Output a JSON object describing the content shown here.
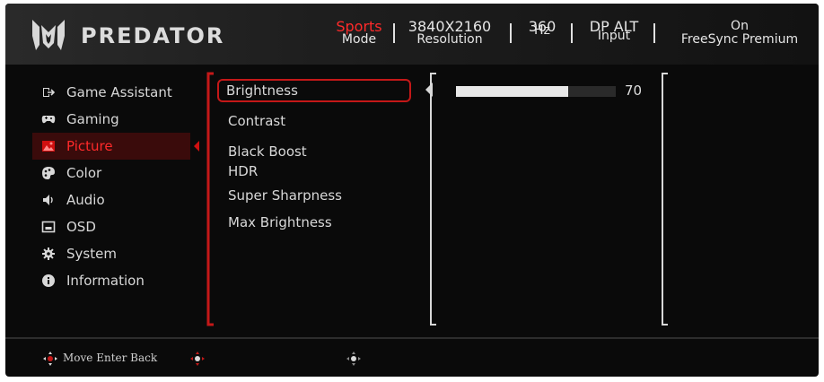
{
  "brand": {
    "name": "PREDATOR"
  },
  "header": {
    "mode": {
      "value": "Sports",
      "label": "Mode"
    },
    "resolution": {
      "value": "3840X2160",
      "label": "Resolution"
    },
    "refresh": {
      "value": "360",
      "label": "Hz"
    },
    "input": {
      "value": "DP ALT",
      "label": "Input"
    },
    "freesync": {
      "value": "On",
      "label": "FreeSync Premium"
    }
  },
  "sidebar": {
    "items": [
      {
        "label": "Game Assistant",
        "icon": "game-assistant-icon"
      },
      {
        "label": "Gaming",
        "icon": "gamepad-icon"
      },
      {
        "label": "Picture",
        "icon": "picture-icon",
        "active": true
      },
      {
        "label": "Color",
        "icon": "palette-icon"
      },
      {
        "label": "Audio",
        "icon": "speaker-icon"
      },
      {
        "label": "OSD",
        "icon": "osd-icon"
      },
      {
        "label": "System",
        "icon": "gear-icon"
      },
      {
        "label": "Information",
        "icon": "info-icon"
      }
    ]
  },
  "submenu": {
    "items": [
      {
        "label": "Brightness",
        "selected": true
      },
      {
        "label": "Contrast"
      },
      {
        "label": "Black Boost"
      },
      {
        "label": "HDR"
      },
      {
        "label": "Super Sharpness"
      },
      {
        "label": "Max Brightness"
      }
    ]
  },
  "brightness": {
    "value": 70,
    "max": 100
  },
  "footer": {
    "text": "Move Enter Back"
  },
  "colors": {
    "accent": "#d01010",
    "text": "#d8d8d8",
    "background": "#0a0a0a"
  }
}
